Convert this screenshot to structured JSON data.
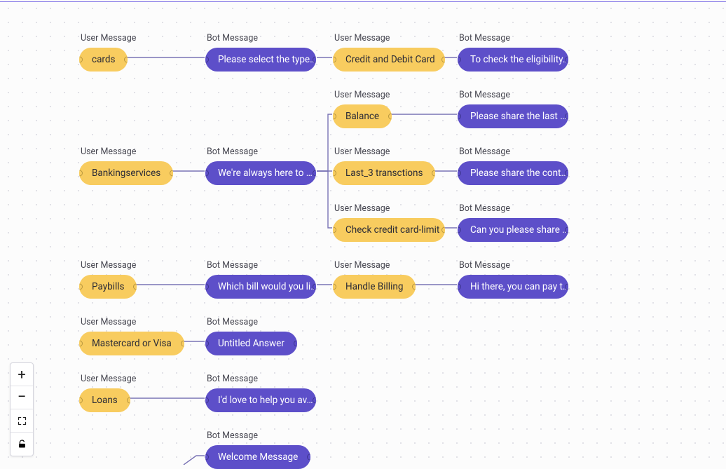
{
  "labels": {
    "user_msg": "User Message",
    "bot_msg": "Bot Message"
  },
  "nodes": {
    "r1_user1": {
      "type": "user",
      "text": "cards"
    },
    "r1_bot1": {
      "type": "bot",
      "text": "Please select the type…"
    },
    "r1_user2": {
      "type": "user",
      "text": "Credit and Debit Card"
    },
    "r1_bot2": {
      "type": "bot",
      "text": "To check the eligibility…"
    },
    "r2a_user": {
      "type": "user",
      "text": "Balance"
    },
    "r2a_bot": {
      "type": "bot",
      "text": "Please share the last …"
    },
    "r2_user1": {
      "type": "user",
      "text": "Bankingservices"
    },
    "r2_bot1": {
      "type": "bot",
      "text": "We're always here to …"
    },
    "r2b_user": {
      "type": "user",
      "text": "Last_3 transctions"
    },
    "r2b_bot": {
      "type": "bot",
      "text": "Please share the cont…"
    },
    "r2c_user": {
      "type": "user",
      "text": "Check credit card-limit"
    },
    "r2c_bot": {
      "type": "bot",
      "text": "Can you please share …"
    },
    "r3_user1": {
      "type": "user",
      "text": "Paybills"
    },
    "r3_bot1": {
      "type": "bot",
      "text": "Which bill would you li…"
    },
    "r3_user2": {
      "type": "user",
      "text": "Handle Billing"
    },
    "r3_bot2": {
      "type": "bot",
      "text": "Hi there, you can pay t…"
    },
    "r4_user": {
      "type": "user",
      "text": "Mastercard or Visa"
    },
    "r4_bot": {
      "type": "bot",
      "text": "Untitled Answer"
    },
    "r5_user": {
      "type": "user",
      "text": "Loans"
    },
    "r5_bot": {
      "type": "bot",
      "text": "I'd love to help you av…"
    },
    "r6_bot": {
      "type": "bot",
      "text": "Welcome Message"
    }
  },
  "toolbar": {
    "zoom_in": "zoom-in",
    "zoom_out": "zoom-out",
    "fit": "fit-view",
    "lock": "lock-toggle"
  }
}
